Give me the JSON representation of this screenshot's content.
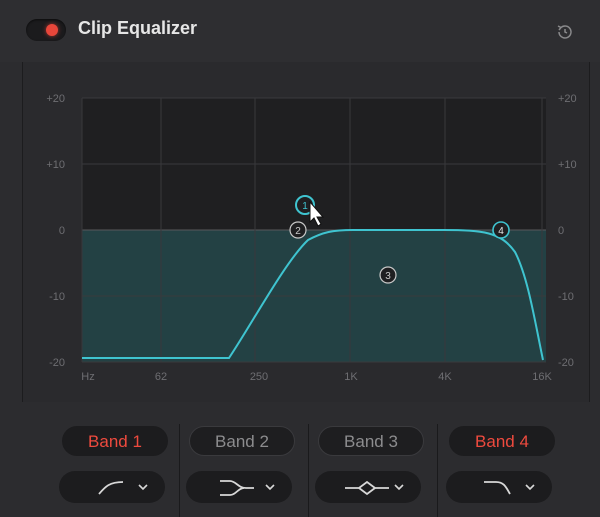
{
  "header": {
    "title": "Clip Equalizer",
    "enabled": true,
    "toggle_color": "#e8463a",
    "reset_icon": "reset-icon"
  },
  "graph": {
    "y_ticks_left": [
      "+20",
      "+10",
      "0",
      "-10",
      "-20"
    ],
    "y_ticks_right": [
      "+20",
      "+10",
      "0",
      "-10",
      "-20"
    ],
    "x_ticks": [
      "Hz",
      "62",
      "250",
      "1K",
      "4K",
      "16K"
    ],
    "curve_color": "#3fc4d0",
    "fill_color": "#275d63",
    "nodes": [
      {
        "label": "1",
        "state": "selected"
      },
      {
        "label": "2",
        "state": "normal"
      },
      {
        "label": "3",
        "state": "normal"
      },
      {
        "label": "4",
        "state": "active"
      }
    ]
  },
  "bands": [
    {
      "label": "Band 1",
      "active": true,
      "filter_icon": "high-pass-icon"
    },
    {
      "label": "Band 2",
      "active": false,
      "filter_icon": "low-shelf-icon"
    },
    {
      "label": "Band 3",
      "active": false,
      "filter_icon": "bell-icon"
    },
    {
      "label": "Band 4",
      "active": true,
      "filter_icon": "low-pass-icon"
    }
  ]
}
